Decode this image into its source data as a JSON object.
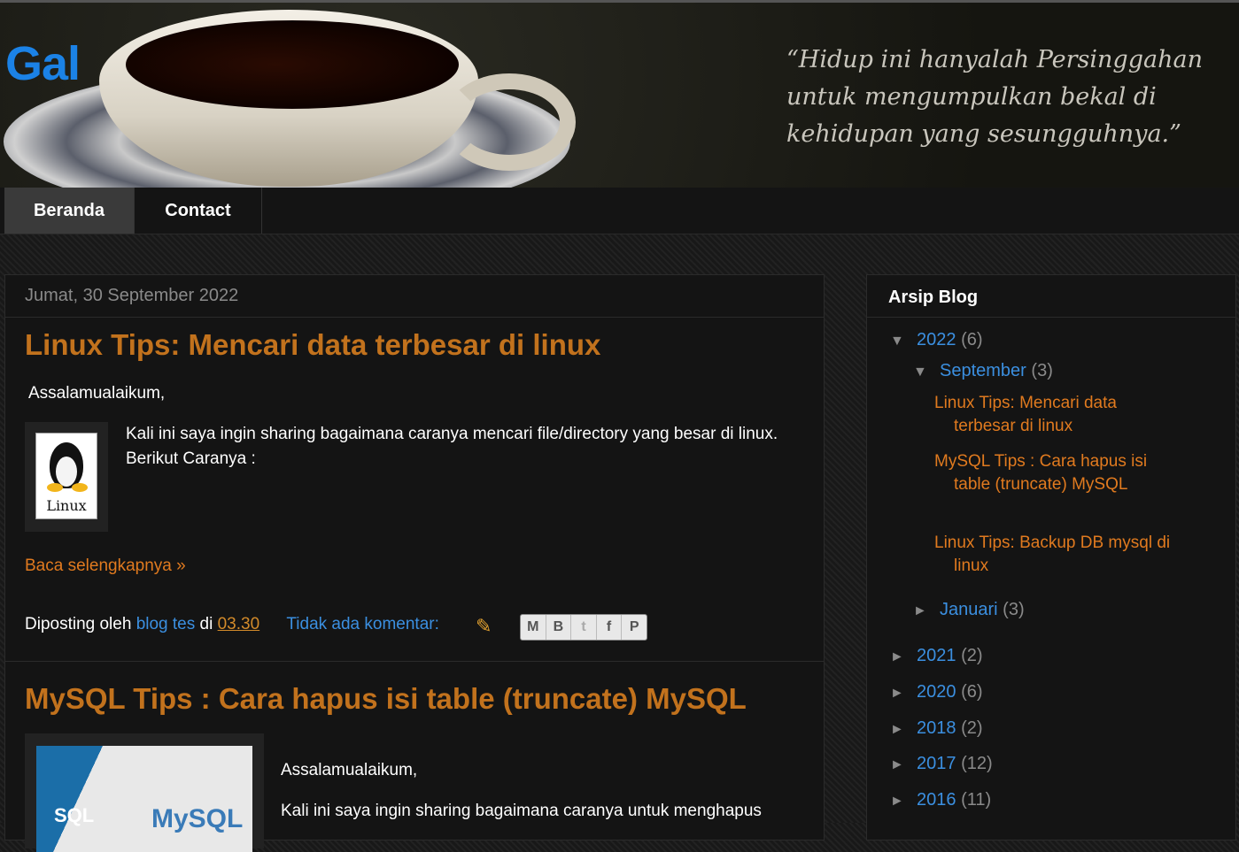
{
  "header": {
    "blog_title": "Gal",
    "quote": "“Hidup ini hanyalah Persinggahan untuk mengumpulkan bekal di kehidupan yang sesungguhnya.”"
  },
  "nav": {
    "items": [
      {
        "label": "Beranda"
      },
      {
        "label": "Contact"
      }
    ]
  },
  "main": {
    "date": "Jumat, 30 September 2022",
    "posts": [
      {
        "title": "Linux Tips: Mencari data terbesar di linux",
        "greeting": "Assalamualaikum,",
        "body": "Kali ini saya ingin sharing bagaimana caranya mencari file/directory yang besar di linux. Berikut Caranya :",
        "image_label": "Linux",
        "read_more": "Baca selengkapnya »",
        "footer": {
          "posted_by": "Diposting oleh",
          "author": "blog tes",
          "at": "di",
          "time": "03.30",
          "comments": "Tidak ada komentar:"
        }
      },
      {
        "title": "MySQL Tips : Cara hapus isi table (truncate) MySQL",
        "greeting": "Assalamualaikum,",
        "body": "Kali ini saya ingin sharing bagaimana caranya untuk menghapus",
        "image_label_sql": "SQL",
        "image_label_mysql": "MySQL"
      }
    ],
    "share_icons": [
      "email-icon",
      "blogger-icon",
      "twitter-icon",
      "facebook-icon",
      "pinterest-icon"
    ]
  },
  "sidebar": {
    "title": "Arsip Blog",
    "archive": {
      "year_2022": {
        "toggle": "▼",
        "label": "2022",
        "count": "(6)"
      },
      "month_sep": {
        "toggle": "▼",
        "label": "September",
        "count": "(3)"
      },
      "sep_posts": [
        "Linux Tips: Mencari data terbesar di linux",
        "MySQL Tips : Cara hapus isi table (truncate) MySQL",
        "Linux Tips: Backup DB mysql di linux"
      ],
      "month_jan": {
        "toggle": "►",
        "label": "Januari",
        "count": "(3)"
      },
      "years": [
        {
          "toggle": "►",
          "label": "2021",
          "count": "(2)"
        },
        {
          "toggle": "►",
          "label": "2020",
          "count": "(6)"
        },
        {
          "toggle": "►",
          "label": "2018",
          "count": "(2)"
        },
        {
          "toggle": "►",
          "label": "2017",
          "count": "(12)"
        },
        {
          "toggle": "►",
          "label": "2016",
          "count": "(11)"
        }
      ]
    }
  },
  "colors": {
    "title_orange": "#c2721d",
    "link_blue": "#3b8fe0",
    "link_orange": "#e07a1f"
  }
}
